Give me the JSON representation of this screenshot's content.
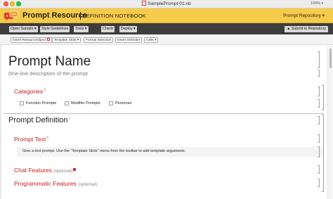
{
  "window": {
    "title": "SamplePrompt-01.nb",
    "zoom": "100%"
  },
  "header": {
    "title": "Prompt Resource",
    "subtitle": "DEFINITION NOTEBOOK",
    "repo_button": "Prompt Repository ▾"
  },
  "toolbar": {
    "buttons": [
      "Open Sample ▾",
      "Style Guidelines",
      "Tools ▾",
      "Check",
      "Deploy ▾"
    ],
    "submit": "Submit to Repository"
  },
  "subtoolbar": {
    "buttons": [
      "Insert ResourceObject",
      "Template Slots ▾",
      "Format Selection",
      "Insert Delimiter",
      "Cells ▾"
    ]
  },
  "notebook": {
    "title": "Prompt Name",
    "description": "One-line description of the prompt",
    "categories": {
      "heading": "Categories",
      "options": [
        "Function Prompts",
        "Modifier Prompts",
        "Personas"
      ]
    },
    "definition_heading": "Prompt Definition",
    "prompt_text_heading": "Prompt Text",
    "prompt_text_body": "Give a text prompt. Use the \"Template Slots\" menu from the toolbar to add template arguments.",
    "chat_features": "Chat Features",
    "programmatic_features": "Programmatic Features",
    "optional_label": "(optional)"
  },
  "colors": {
    "header_yellow": "#f6cb49",
    "toolbar_dark": "#3d3d3d",
    "section_red": "#c41d1d"
  }
}
